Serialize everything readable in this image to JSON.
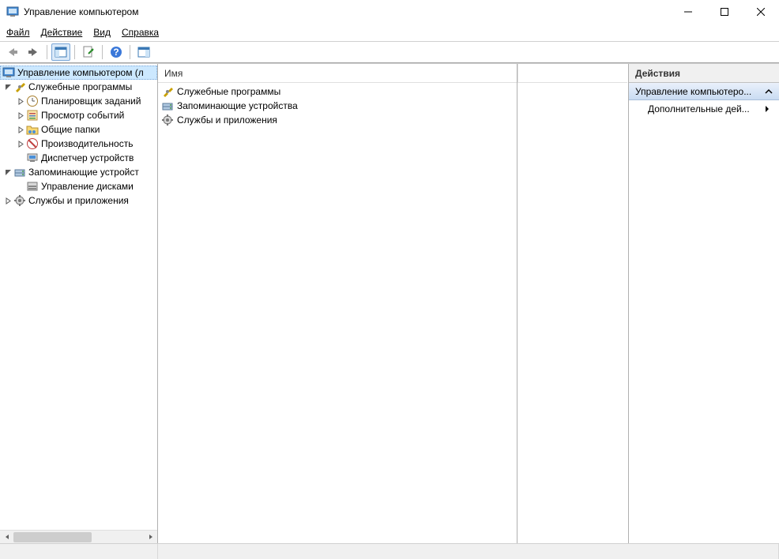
{
  "window": {
    "title": "Управление компьютером"
  },
  "menu": {
    "file": "Файл",
    "action": "Действие",
    "view": "Вид",
    "help": "Справка"
  },
  "tree": {
    "root": "Управление компьютером (л",
    "system_tools": "Служебные программы",
    "task_scheduler": "Планировщик заданий",
    "event_viewer": "Просмотр событий",
    "shared_folders": "Общие папки",
    "performance": "Производительность",
    "device_manager": "Диспетчер устройств",
    "storage": "Запоминающие устройст",
    "disk_mgmt": "Управление дисками",
    "services_apps": "Службы и приложения"
  },
  "list": {
    "header": "Имя",
    "item1": "Служебные программы",
    "item2": "Запоминающие устройства",
    "item3": "Службы и приложения"
  },
  "actions": {
    "header": "Действия",
    "section": "Управление компьютеро...",
    "more": "Дополнительные дей..."
  }
}
